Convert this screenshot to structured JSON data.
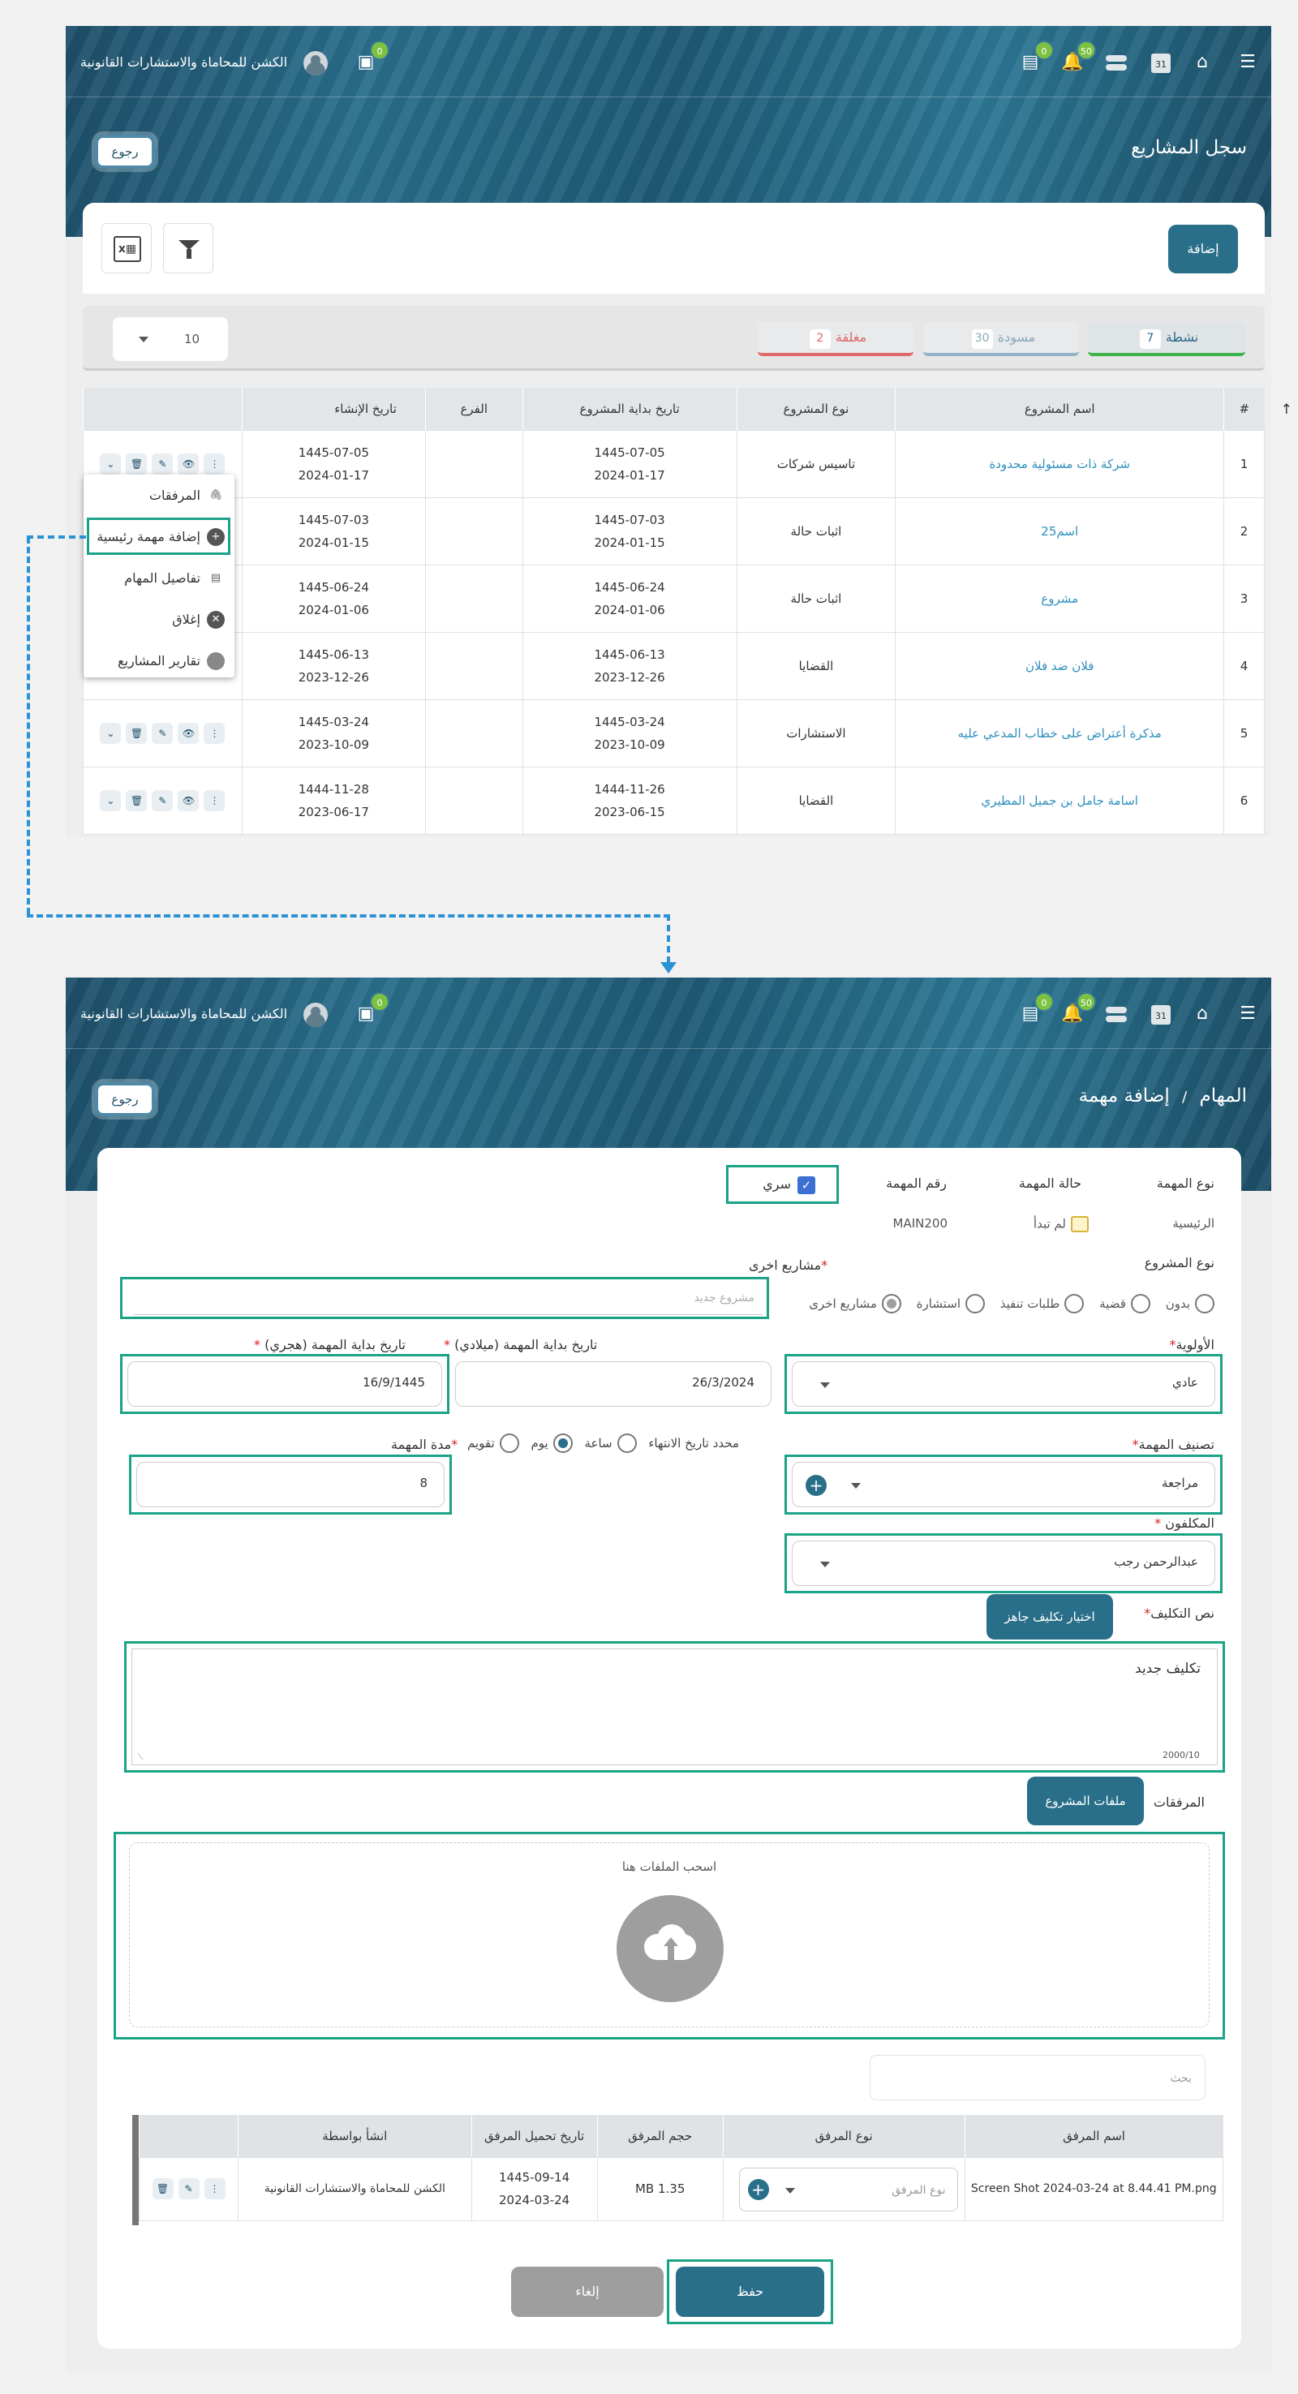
{
  "app": {
    "brand": "الكشن للمحاماة والاستشارات القانونية",
    "badges": {
      "messages": "0",
      "bell": "50",
      "chat": "0"
    },
    "calendar_day": "31"
  },
  "projects_page": {
    "title": "سجل المشاريع",
    "back_label": "رجوع",
    "add_label": "إضافة",
    "status_tabs": [
      {
        "label": "نشطة",
        "count": "7",
        "color": "#3db54a"
      },
      {
        "label": "مسودة",
        "count": "30",
        "color": "#90b4c8"
      },
      {
        "label": "مغلقة",
        "count": "2",
        "color": "#e06a6a"
      }
    ],
    "page_size": "10",
    "table": {
      "headers": [
        "#",
        "اسم المشروع",
        "نوع المشروع",
        "تاريخ بداية المشروع",
        "الفرع",
        "تاريخ الإنشاء"
      ],
      "rows": [
        {
          "num": "1",
          "name": "شركة ذات مسئولية محدودة",
          "type": "تاسيس شركات",
          "start_h": "1445-07-05",
          "start_g": "2024-01-17",
          "branch": "",
          "created_h": "1445-07-05",
          "created_g": "2024-01-17"
        },
        {
          "num": "2",
          "name": "اسم25",
          "type": "اثبات حالة",
          "start_h": "1445-07-03",
          "start_g": "2024-01-15",
          "branch": "",
          "created_h": "1445-07-03",
          "created_g": "2024-01-15"
        },
        {
          "num": "3",
          "name": "مشروع",
          "type": "اثبات حالة",
          "start_h": "1445-06-24",
          "start_g": "2024-01-06",
          "branch": "",
          "created_h": "1445-06-24",
          "created_g": "2024-01-06"
        },
        {
          "num": "4",
          "name": "فلان ضد فلان",
          "type": "القضايا",
          "start_h": "1445-06-13",
          "start_g": "2023-12-26",
          "branch": "",
          "created_h": "1445-06-13",
          "created_g": "2023-12-26"
        },
        {
          "num": "5",
          "name": "مذكرة أعتراض على خطاب المدعي عليه",
          "type": "الاستشارات",
          "start_h": "1445-03-24",
          "start_g": "2023-10-09",
          "branch": "",
          "created_h": "1445-03-24",
          "created_g": "2023-10-09"
        },
        {
          "num": "6",
          "name": "اسامة جامل بن جميل المطيري",
          "type": "القضايا",
          "start_h": "1444-11-26",
          "start_g": "2023-06-15",
          "branch": "",
          "created_h": "1444-11-28",
          "created_g": "2023-06-17"
        }
      ]
    },
    "menu": [
      "المرفقات",
      "إضافة مهمة رئيسية",
      "تفاصيل المهام",
      "إغلاق",
      "تقارير المشاريع"
    ]
  },
  "task_page": {
    "breadcrumb_root": "المهام",
    "breadcrumb_sep": "/",
    "title": "إضافة مهمة",
    "back_label": "رجوع",
    "info_headers": {
      "type": "نوع المهمة",
      "status": "حالة المهمة",
      "number": "رقم المهمة",
      "secret": "سري"
    },
    "info_values": {
      "type": "الرئيسية",
      "status": "لم تبدأ",
      "number": "MAIN200"
    },
    "project_type_label": "نوع المشروع",
    "project_types": [
      "بدون",
      "قضية",
      "طلبات تنفيذ",
      "استشارة",
      "مشاريع اخرى"
    ],
    "other_projects_label": "مشاريع اخرى",
    "other_projects_placeholder": "مشروع جديد",
    "priority_label": "الأولوية",
    "priority_value": "عادي",
    "start_g_label": "تاريخ بداية المهمة (ميلادي)",
    "start_g_value": "26/3/2024",
    "start_h_label": "تاريخ بداية المهمة (هجري)",
    "start_h_value": "16/9/1445",
    "classification_label": "تصنيف المهمة",
    "classification_value": "مراجعة",
    "duration_modes": [
      "محدد تاريخ الانتهاء",
      "ساعة",
      "يوم",
      "تقويم"
    ],
    "duration_label": "مدة المهمة",
    "duration_value": "8",
    "assignees_label": "المكلفون",
    "assignees_value": "عبدالرحمن رجب",
    "assign_text_label": "نص التكليف",
    "ready_btn": "اختيار تكليف جاهز",
    "assign_text": "تكليف جديد",
    "char_count": "2000/10",
    "attachments_label": "المرفقات",
    "project_files_btn": "ملفات المشروع",
    "drop_text": "اسحب الملفات هنا",
    "search_placeholder": "بحث",
    "att_table": {
      "headers": [
        "اسم المرفق",
        "نوع المرفق",
        "حجم المرفق",
        "تاريخ تحميل المرفق",
        "انشأ بواسطة"
      ],
      "row": {
        "name": "Screen Shot 2024-03-24 at 8.44.41 PM.png",
        "type_placeholder": "نوع المرفق",
        "size": "MB 1.35",
        "date_h": "1445-09-14",
        "date_g": "2024-03-24",
        "by": "الكشن للمحاماة والاستشارات القانونية"
      }
    },
    "save": "حفظ",
    "cancel": "إلغاء"
  }
}
